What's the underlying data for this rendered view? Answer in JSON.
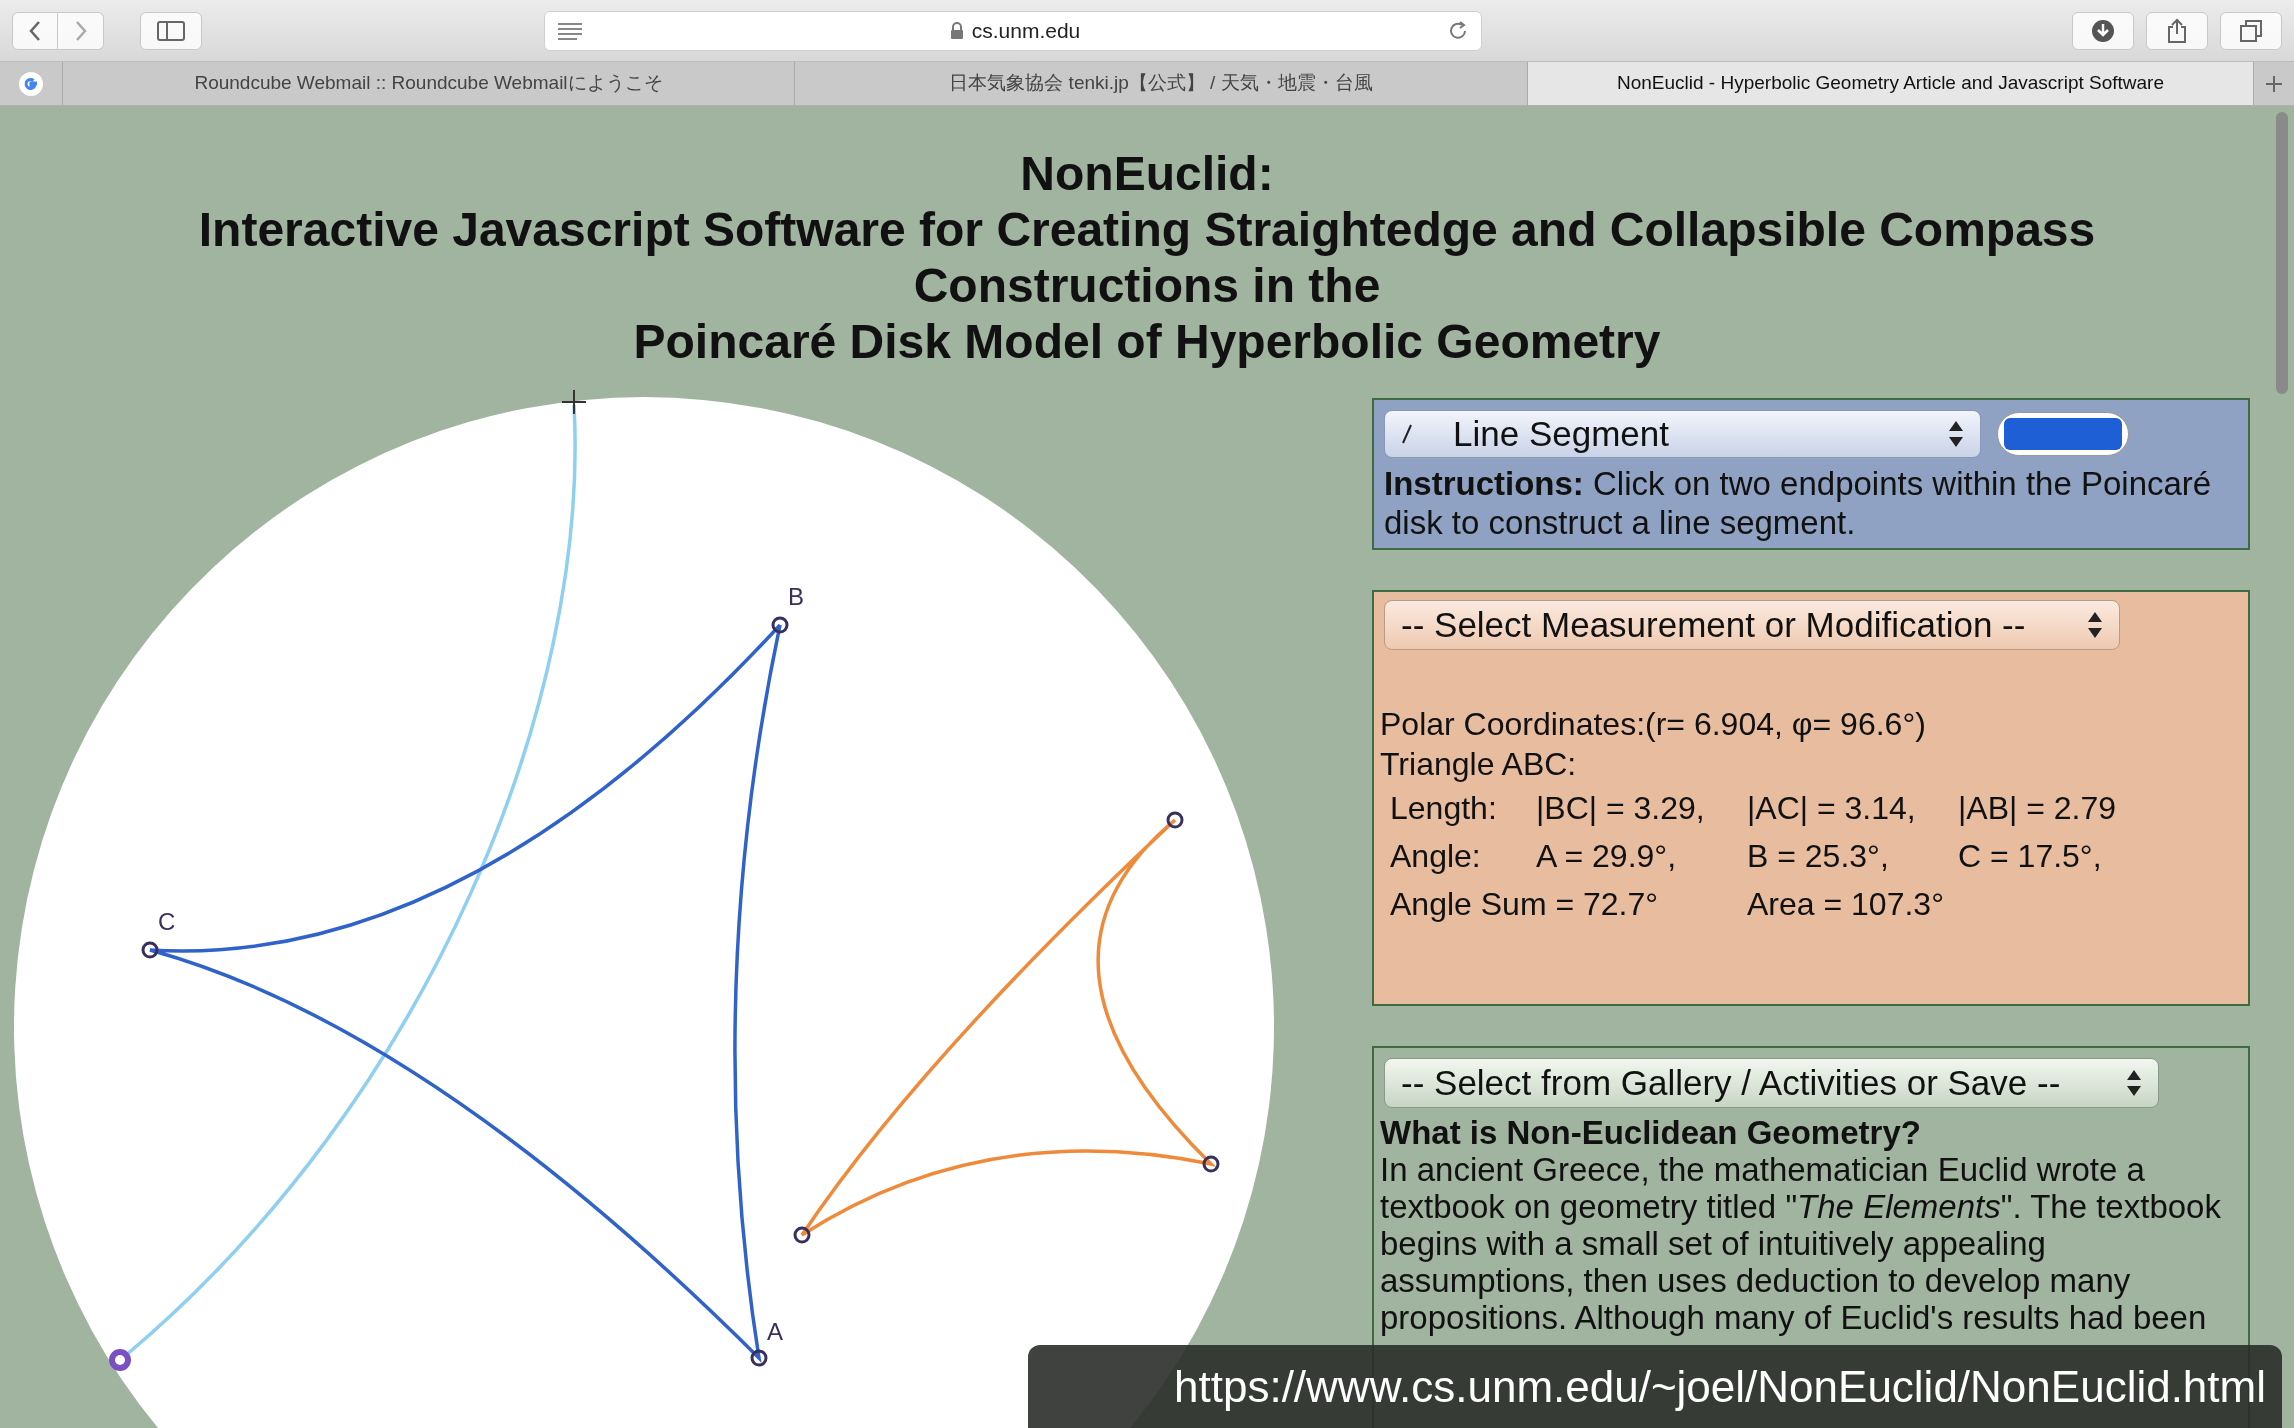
{
  "browser": {
    "url": "cs.unm.edu",
    "tabs": [
      {
        "title": "Roundcube Webmail :: Roundcube Webmailにようこそ",
        "selected": false
      },
      {
        "title": "日本気象協会 tenki.jp【公式】 / 天気・地震・台風",
        "selected": false
      },
      {
        "title": "NonEuclid - Hyperbolic Geometry Article and Javascript Software",
        "selected": true
      }
    ]
  },
  "page": {
    "title_lines": [
      "NonEuclid:",
      "Interactive Javascript Software for Creating Straightedge and Collapsible Compass",
      "Constructions in the",
      "Poincaré Disk Model of Hyperbolic Geometry"
    ]
  },
  "figures": [
    {
      "kind": "segment",
      "color": "#8ecff2"
    },
    {
      "kind": "triangle",
      "color": "#2f63c9",
      "labels": [
        "B",
        "C",
        "A"
      ]
    },
    {
      "kind": "triangle",
      "color": "#ef8a3a"
    }
  ],
  "tool_panel": {
    "tool": "Line Segment",
    "color": "#1f5fd6",
    "instructions": "**Instructions:** Click on two endpoints within the Poincaré disk to construct a line segment."
  },
  "measurement_panel": {
    "select": "-- Select Measurement or Modification --",
    "lines": [
      "Polar Coordinates:(r= 6.904, φ= 96.6°)",
      "Triangle ABC:"
    ],
    "rows": [
      {
        "cells": [
          "Length:",
          "|BC| = 3.29,",
          "|AC| = 3.14,",
          "|AB| = 2.79"
        ]
      },
      {
        "cells": [
          "Angle:",
          "A = 29.9°,",
          "B = 25.3°,",
          "C = 17.5°,"
        ]
      },
      {
        "cells": [
          "Angle Sum = 72.7°",
          "",
          "Area = 107.3°"
        ]
      }
    ]
  },
  "gallery_panel": {
    "select": "-- Select from Gallery / Activities or Save --",
    "heading": "What is Non-Euclidean Geometry?",
    "paragraph": "In ancient Greece, the mathematician Euclid wrote a textbook on geometry titled \"*The Elements*\". The textbook begins with a small set of intuitively appealing assumptions, then uses deduction to develop many propositions. Although many of Euclid's results had been"
  },
  "caption": "https://www.cs.unm.edu/~joel/NonEuclid/NonEuclid.html"
}
